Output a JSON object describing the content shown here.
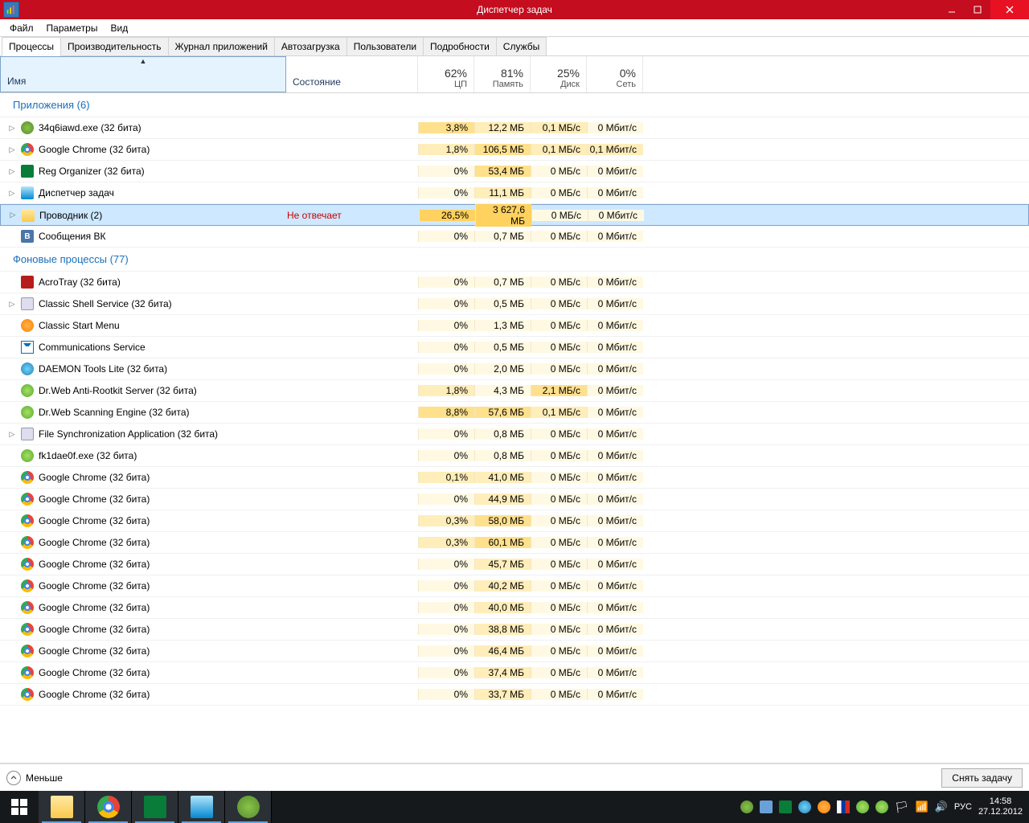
{
  "window": {
    "title": "Диспетчер задач"
  },
  "menubar": [
    "Файл",
    "Параметры",
    "Вид"
  ],
  "tabs": [
    "Процессы",
    "Производительность",
    "Журнал приложений",
    "Автозагрузка",
    "Пользователи",
    "Подробности",
    "Службы"
  ],
  "active_tab": 0,
  "columns": {
    "name": "Имя",
    "state": "Состояние",
    "cpu": {
      "pct": "62%",
      "label": "ЦП"
    },
    "mem": {
      "pct": "81%",
      "label": "Память"
    },
    "disk": {
      "pct": "25%",
      "label": "Диск"
    },
    "net": {
      "pct": "0%",
      "label": "Сеть"
    }
  },
  "groups": [
    {
      "label": "Приложения (6)",
      "rows": [
        {
          "exp": true,
          "icon": "ic-green",
          "name": "34q6iawd.exe (32 бита)",
          "state": "",
          "cpu": "3,8%",
          "mem": "12,2 МБ",
          "disk": "0,1 МБ/с",
          "net": "0 Мбит/с",
          "h": [
            2,
            1,
            1,
            0
          ]
        },
        {
          "exp": true,
          "icon": "ic-chrome",
          "name": "Google Chrome (32 бита)",
          "state": "",
          "cpu": "1,8%",
          "mem": "106,5 МБ",
          "disk": "0,1 МБ/с",
          "net": "0,1 Мбит/с",
          "h": [
            1,
            2,
            1,
            1
          ]
        },
        {
          "exp": true,
          "icon": "ic-reg",
          "name": "Reg Organizer (32 бита)",
          "state": "",
          "cpu": "0%",
          "mem": "53,4 МБ",
          "disk": "0 МБ/с",
          "net": "0 Мбит/с",
          "h": [
            0,
            2,
            0,
            0
          ]
        },
        {
          "exp": true,
          "icon": "ic-task",
          "name": "Диспетчер задач",
          "state": "",
          "cpu": "0%",
          "mem": "11,1 МБ",
          "disk": "0 МБ/с",
          "net": "0 Мбит/с",
          "h": [
            0,
            1,
            0,
            0
          ]
        },
        {
          "exp": true,
          "icon": "ic-folder",
          "name": "Проводник (2)",
          "state": "Не отвечает",
          "stateErr": true,
          "sel": true,
          "cpu": "26,5%",
          "mem": "3 627,6 МБ",
          "disk": "0 МБ/с",
          "net": "0 Мбит/с",
          "h": [
            3,
            3,
            0,
            0
          ]
        },
        {
          "exp": false,
          "icon": "ic-vk",
          "vk": "B",
          "name": "Сообщения ВК",
          "state": "",
          "cpu": "0%",
          "mem": "0,7 МБ",
          "disk": "0 МБ/с",
          "net": "0 Мбит/с",
          "h": [
            0,
            0,
            0,
            0
          ]
        }
      ]
    },
    {
      "label": "Фоновые процессы (77)",
      "rows": [
        {
          "exp": false,
          "icon": "ic-acro",
          "name": "AcroTray (32 бита)",
          "cpu": "0%",
          "mem": "0,7 МБ",
          "disk": "0 МБ/с",
          "net": "0 Мбит/с",
          "h": [
            0,
            0,
            0,
            0
          ]
        },
        {
          "exp": true,
          "icon": "ic-shell",
          "name": "Classic Shell Service (32 бита)",
          "cpu": "0%",
          "mem": "0,5 МБ",
          "disk": "0 МБ/с",
          "net": "0 Мбит/с",
          "h": [
            0,
            0,
            0,
            0
          ]
        },
        {
          "exp": false,
          "icon": "ic-start",
          "name": "Classic Start Menu",
          "cpu": "0%",
          "mem": "1,3 МБ",
          "disk": "0 МБ/с",
          "net": "0 Мбит/с",
          "h": [
            0,
            0,
            0,
            0
          ]
        },
        {
          "exp": false,
          "icon": "ic-mail",
          "name": "Communications Service",
          "cpu": "0%",
          "mem": "0,5 МБ",
          "disk": "0 МБ/с",
          "net": "0 Мбит/с",
          "h": [
            0,
            0,
            0,
            0
          ]
        },
        {
          "exp": false,
          "icon": "ic-daemon",
          "name": "DAEMON Tools Lite (32 бита)",
          "cpu": "0%",
          "mem": "2,0 МБ",
          "disk": "0 МБ/с",
          "net": "0 Мбит/с",
          "h": [
            0,
            0,
            0,
            0
          ]
        },
        {
          "exp": false,
          "icon": "ic-drweb",
          "name": "Dr.Web Anti-Rootkit Server (32 бита)",
          "cpu": "1,8%",
          "mem": "4,3 МБ",
          "disk": "2,1 МБ/с",
          "net": "0 Мбит/с",
          "h": [
            1,
            0,
            2,
            0
          ]
        },
        {
          "exp": false,
          "icon": "ic-drweb",
          "name": "Dr.Web Scanning Engine (32 бита)",
          "cpu": "8,8%",
          "mem": "57,6 МБ",
          "disk": "0,1 МБ/с",
          "net": "0 Мбит/с",
          "h": [
            2,
            2,
            1,
            0
          ]
        },
        {
          "exp": true,
          "icon": "ic-shell",
          "name": "File Synchronization Application (32 бита)",
          "cpu": "0%",
          "mem": "0,8 МБ",
          "disk": "0 МБ/с",
          "net": "0 Мбит/с",
          "h": [
            0,
            0,
            0,
            0
          ]
        },
        {
          "exp": false,
          "icon": "ic-drweb",
          "name": "fk1dae0f.exe (32 бита)",
          "cpu": "0%",
          "mem": "0,8 МБ",
          "disk": "0 МБ/с",
          "net": "0 Мбит/с",
          "h": [
            0,
            0,
            0,
            0
          ]
        },
        {
          "exp": false,
          "icon": "ic-chrome",
          "name": "Google Chrome (32 бита)",
          "cpu": "0,1%",
          "mem": "41,0 МБ",
          "disk": "0 МБ/с",
          "net": "0 Мбит/с",
          "h": [
            1,
            1,
            0,
            0
          ]
        },
        {
          "exp": false,
          "icon": "ic-chrome",
          "name": "Google Chrome (32 бита)",
          "cpu": "0%",
          "mem": "44,9 МБ",
          "disk": "0 МБ/с",
          "net": "0 Мбит/с",
          "h": [
            0,
            1,
            0,
            0
          ]
        },
        {
          "exp": false,
          "icon": "ic-chrome",
          "name": "Google Chrome (32 бита)",
          "cpu": "0,3%",
          "mem": "58,0 МБ",
          "disk": "0 МБ/с",
          "net": "0 Мбит/с",
          "h": [
            1,
            2,
            0,
            0
          ]
        },
        {
          "exp": false,
          "icon": "ic-chrome",
          "name": "Google Chrome (32 бита)",
          "cpu": "0,3%",
          "mem": "60,1 МБ",
          "disk": "0 МБ/с",
          "net": "0 Мбит/с",
          "h": [
            1,
            2,
            0,
            0
          ]
        },
        {
          "exp": false,
          "icon": "ic-chrome",
          "name": "Google Chrome (32 бита)",
          "cpu": "0%",
          "mem": "45,7 МБ",
          "disk": "0 МБ/с",
          "net": "0 Мбит/с",
          "h": [
            0,
            1,
            0,
            0
          ]
        },
        {
          "exp": false,
          "icon": "ic-chrome",
          "name": "Google Chrome (32 бита)",
          "cpu": "0%",
          "mem": "40,2 МБ",
          "disk": "0 МБ/с",
          "net": "0 Мбит/с",
          "h": [
            0,
            1,
            0,
            0
          ]
        },
        {
          "exp": false,
          "icon": "ic-chrome",
          "name": "Google Chrome (32 бита)",
          "cpu": "0%",
          "mem": "40,0 МБ",
          "disk": "0 МБ/с",
          "net": "0 Мбит/с",
          "h": [
            0,
            1,
            0,
            0
          ]
        },
        {
          "exp": false,
          "icon": "ic-chrome",
          "name": "Google Chrome (32 бита)",
          "cpu": "0%",
          "mem": "38,8 МБ",
          "disk": "0 МБ/с",
          "net": "0 Мбит/с",
          "h": [
            0,
            1,
            0,
            0
          ]
        },
        {
          "exp": false,
          "icon": "ic-chrome",
          "name": "Google Chrome (32 бита)",
          "cpu": "0%",
          "mem": "46,4 МБ",
          "disk": "0 МБ/с",
          "net": "0 Мбит/с",
          "h": [
            0,
            1,
            0,
            0
          ]
        },
        {
          "exp": false,
          "icon": "ic-chrome",
          "name": "Google Chrome (32 бита)",
          "cpu": "0%",
          "mem": "37,4 МБ",
          "disk": "0 МБ/с",
          "net": "0 Мбит/с",
          "h": [
            0,
            1,
            0,
            0
          ]
        },
        {
          "exp": false,
          "icon": "ic-chrome",
          "name": "Google Chrome (32 бита)",
          "cpu": "0%",
          "mem": "33,7 МБ",
          "disk": "0 МБ/с",
          "net": "0 Мбит/с",
          "h": [
            0,
            1,
            0,
            0
          ]
        }
      ]
    }
  ],
  "footer": {
    "fewer": "Меньше",
    "end_task": "Снять задачу"
  },
  "taskbar": {
    "lang": "РУС",
    "time": "14:58",
    "date": "27.12.2012"
  }
}
